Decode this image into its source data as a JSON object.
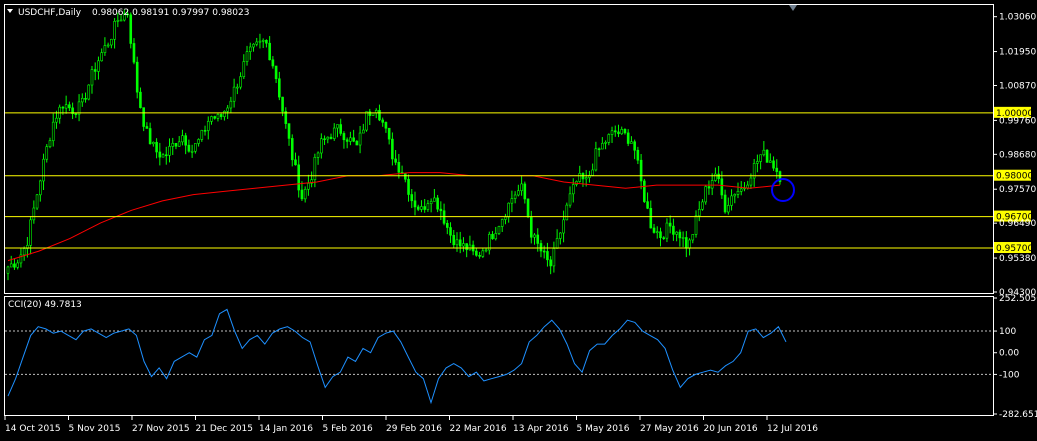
{
  "header": {
    "title": "USDCHF,Daily",
    "ohlc": "0.98062 0.98191 0.97997 0.98023",
    "dropdown_icon": "triangle-down-icon"
  },
  "colors": {
    "background": "#000000",
    "frame": "#ffffff",
    "candle": "#00ff00",
    "ma": "#ff0000",
    "level_line": "#ffff00",
    "level_label_bg": "#ffff00",
    "cci": "#1e90ff",
    "circle": "#0000ff"
  },
  "chart_data": [
    {
      "type": "candlestick",
      "title": "USDCHF,Daily",
      "grid": false,
      "ylim": [
        0.943,
        1.034
      ],
      "y_ticks": [
        "1.03060",
        "1.01950",
        "1.00870",
        "0.99760",
        "0.98680",
        "0.97570",
        "0.96490",
        "0.95380",
        "0.94300"
      ],
      "x_ticks": [
        "14 Oct 2015",
        "5 Nov 2015",
        "27 Nov 2015",
        "21 Dec 2015",
        "14 Jan 2016",
        "5 Feb 2016",
        "29 Feb 2016",
        "22 Mar 2016",
        "13 Apr 2016",
        "5 May 2016",
        "27 May 2016",
        "20 Jun 2016",
        "12 Jul 2016"
      ],
      "close_path": [
        0.951,
        0.953,
        0.958,
        0.972,
        0.986,
        0.998,
        1.003,
        1.001,
        1.002,
        1.011,
        1.018,
        1.023,
        1.03,
        1.032,
        1.008,
        0.994,
        0.988,
        0.986,
        0.99,
        0.993,
        0.988,
        0.992,
        0.999,
        0.998,
        1.003,
        1.01,
        1.018,
        1.021,
        1.023,
        1.014,
        0.999,
        0.985,
        0.973,
        0.98,
        0.99,
        0.993,
        0.995,
        0.992,
        0.989,
        0.999,
        1.003,
        0.995,
        0.985,
        0.981,
        0.972,
        0.969,
        0.974,
        0.97,
        0.962,
        0.958,
        0.957,
        0.954,
        0.958,
        0.963,
        0.968,
        0.974,
        0.976,
        0.961,
        0.956,
        0.951,
        0.961,
        0.972,
        0.979,
        0.978,
        0.987,
        0.991,
        0.994,
        0.993,
        0.991,
        0.976,
        0.964,
        0.961,
        0.964,
        0.962,
        0.957,
        0.967,
        0.976,
        0.981,
        0.97,
        0.975,
        0.976,
        0.982,
        0.987,
        0.985,
        0.98
      ],
      "ma_path": [
        0.953,
        0.956,
        0.96,
        0.965,
        0.969,
        0.972,
        0.974,
        0.975,
        0.976,
        0.977,
        0.978,
        0.98,
        0.98,
        0.981,
        0.981,
        0.98,
        0.98,
        0.98,
        0.978,
        0.977,
        0.976,
        0.977,
        0.977,
        0.977,
        0.976,
        0.977
      ],
      "levels": [
        {
          "label": "1.00000",
          "value": 1.0
        },
        {
          "label": "0.98000",
          "value": 0.98
        },
        {
          "label": "0.96700",
          "value": 0.967
        },
        {
          "label": "0.95700",
          "value": 0.957
        }
      ]
    },
    {
      "type": "line",
      "title": "CCI(20) 49.7813",
      "grid": false,
      "ylim": [
        -282.6519,
        252.5056
      ],
      "y_ticks": [
        "252.5056",
        "100",
        "0.00",
        "-100",
        "-282.6519"
      ],
      "reference_lines": [
        100,
        -100
      ],
      "values": [
        -200,
        -120,
        -20,
        80,
        120,
        110,
        90,
        100,
        80,
        60,
        100,
        110,
        90,
        70,
        90,
        100,
        110,
        80,
        -40,
        -110,
        -70,
        -120,
        -40,
        -20,
        0,
        -20,
        60,
        80,
        180,
        200,
        100,
        20,
        60,
        80,
        40,
        90,
        110,
        120,
        100,
        70,
        50,
        -60,
        -160,
        -110,
        -90,
        -20,
        -40,
        20,
        0,
        70,
        90,
        100,
        50,
        -20,
        -90,
        -120,
        -230,
        -120,
        -70,
        -50,
        -70,
        -110,
        -90,
        -130,
        -120,
        -110,
        -100,
        -80,
        -50,
        50,
        80,
        120,
        150,
        110,
        40,
        -50,
        -90,
        10,
        40,
        40,
        80,
        110,
        150,
        140,
        100,
        80,
        60,
        20,
        -80,
        -160,
        -120,
        -100,
        -90,
        -80,
        -90,
        -60,
        -40,
        0,
        100,
        110,
        70,
        90,
        120,
        50
      ]
    }
  ]
}
